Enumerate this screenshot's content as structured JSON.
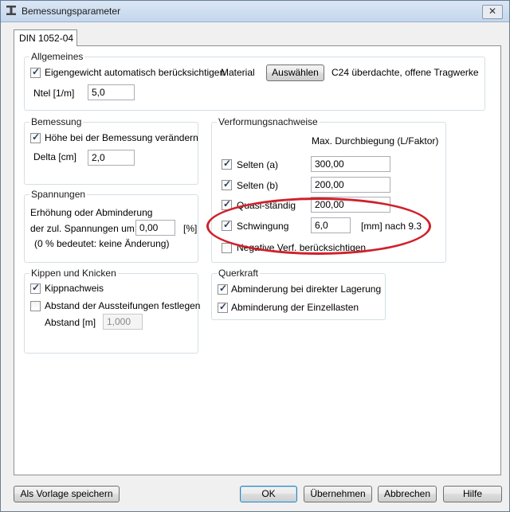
{
  "window": {
    "title": "Bemessungsparameter",
    "close": "✕"
  },
  "tab": {
    "label": "DIN 1052-04"
  },
  "allgemeines": {
    "title": "Allgemeines",
    "eigengewicht": {
      "label": "Eigengewicht automatisch berücksichtigen",
      "checked": true
    },
    "material_label": "Material",
    "auswaehlen": "Auswählen",
    "material_value": "C24 überdachte, offene Tragwerke",
    "ntel_label": "Ntel [1/m]",
    "ntel_value": "5,0"
  },
  "bemessung": {
    "title": "Bemessung",
    "hoehe": {
      "label": "Höhe bei der Bemessung verändern",
      "checked": true
    },
    "delta_label": "Delta [cm]",
    "delta_value": "2,0"
  },
  "spannungen": {
    "title": "Spannungen",
    "line1": "Erhöhung oder Abminderung",
    "line2": "der zul. Spannungen um:",
    "value": "0,00",
    "unit": "[%]",
    "note": "(0 % bedeutet: keine Änderung)"
  },
  "kippen": {
    "title": "Kippen und Knicken",
    "kippnachweis": {
      "label": "Kippnachweis",
      "checked": true
    },
    "abstand_festlegen": {
      "label": "Abstand der Aussteifungen festlegen",
      "checked": false
    },
    "abstand_label": "Abstand [m]",
    "abstand_value": "1,000"
  },
  "verformung": {
    "title": "Verformungsnachweise",
    "header": "Max. Durchbiegung (L/Faktor)",
    "rows": [
      {
        "label": "Selten (a)",
        "value": "300,00",
        "checked": true
      },
      {
        "label": "Selten (b)",
        "value": "200,00",
        "checked": true
      },
      {
        "label": "Quasi-ständig",
        "value": "200,00",
        "checked": true
      },
      {
        "label": "Schwingung",
        "value": "6,0",
        "checked": true,
        "suffix": "[mm] nach 9.3"
      }
    ],
    "negative": {
      "label": "Negative Verf. berücksichtigen",
      "checked": false
    }
  },
  "querkraft": {
    "title": "Querkraft",
    "lagerung": {
      "label": "Abminderung bei direkter Lagerung",
      "checked": true
    },
    "einzellasten": {
      "label": "Abminderung der Einzellasten",
      "checked": true
    }
  },
  "footer": {
    "vorlage": "Als Vorlage speichern",
    "ok": "OK",
    "uebernehmen": "Übernehmen",
    "abbrechen": "Abbrechen",
    "hilfe": "Hilfe"
  },
  "annotation": {
    "color": "#d0202a"
  }
}
